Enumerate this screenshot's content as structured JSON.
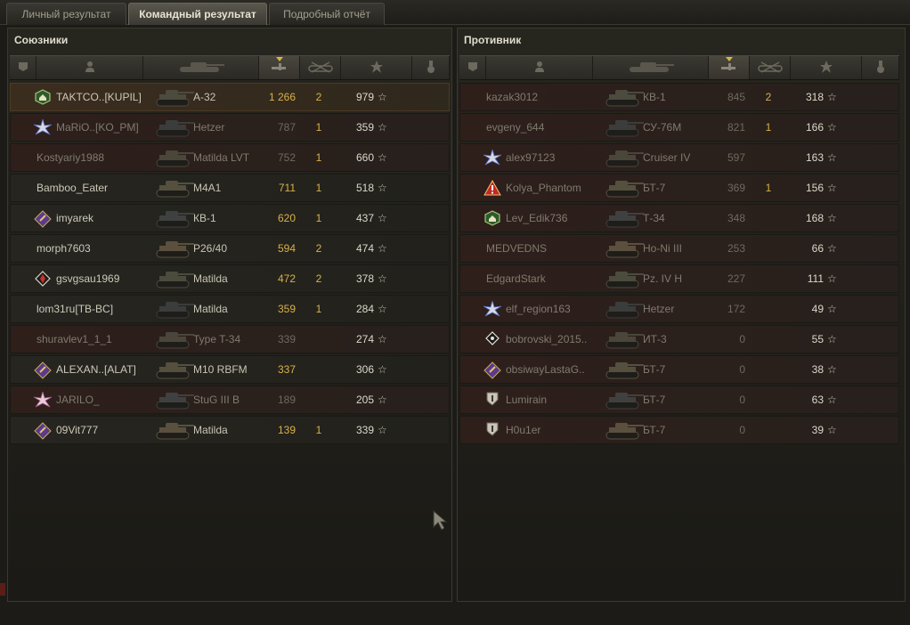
{
  "tabs": [
    "Личный результат",
    "Командный результат",
    "Подробный отчёт"
  ],
  "active_tab": 1,
  "allies": {
    "title": "Союзники",
    "rows": [
      {
        "name": "TAKTCO..[KUPIL]",
        "badge": "house-emblem-icon",
        "vehicle": "А-32",
        "damage": "1 266",
        "kills": "2",
        "xp": "979",
        "state": "me"
      },
      {
        "name": "MaRiO..[KO_PM]",
        "badge": "star-burst-icon",
        "vehicle": "Hetzer",
        "damage": "787",
        "kills": "1",
        "xp": "359",
        "state": "dead"
      },
      {
        "name": "Kostyariy1988",
        "badge": "",
        "vehicle": "Matilda LVT",
        "damage": "752",
        "kills": "1",
        "xp": "660",
        "state": "dead"
      },
      {
        "name": "Bamboo_Eater",
        "badge": "",
        "vehicle": "M4A1",
        "damage": "711",
        "kills": "1",
        "xp": "518",
        "state": "alive"
      },
      {
        "name": "imyarek",
        "badge": "purple-diamond-icon",
        "vehicle": "КВ-1",
        "damage": "620",
        "kills": "1",
        "xp": "437",
        "state": "alive"
      },
      {
        "name": "morph7603",
        "badge": "",
        "vehicle": "P26/40",
        "damage": "594",
        "kills": "2",
        "xp": "474",
        "state": "alive"
      },
      {
        "name": "gsvgsau1969",
        "badge": "red-diamond-icon",
        "vehicle": "Matilda",
        "damage": "472",
        "kills": "2",
        "xp": "378",
        "state": "alive"
      },
      {
        "name": "lom31ru[TB-BC]",
        "badge": "",
        "vehicle": "Matilda",
        "damage": "359",
        "kills": "1",
        "xp": "284",
        "state": "alive"
      },
      {
        "name": "shuravlev1_1_1",
        "badge": "",
        "vehicle": "Type T-34",
        "damage": "339",
        "kills": "",
        "xp": "274",
        "state": "dead"
      },
      {
        "name": "ALEXAN..[ALAT]",
        "badge": "purple-diamond-icon",
        "vehicle": "M10 RBFM",
        "damage": "337",
        "kills": "",
        "xp": "306",
        "state": "alive"
      },
      {
        "name": "JARILO_",
        "badge": "pink-burst-icon",
        "vehicle": "StuG III B",
        "damage": "189",
        "kills": "",
        "xp": "205",
        "state": "dead"
      },
      {
        "name": "09Vit777",
        "badge": "purple-diamond-icon",
        "vehicle": "Matilda",
        "damage": "139",
        "kills": "1",
        "xp": "339",
        "state": "alive"
      }
    ]
  },
  "enemies": {
    "title": "Противник",
    "rows": [
      {
        "name": "kazak3012",
        "badge": "",
        "vehicle": "КВ-1",
        "damage": "845",
        "kills": "2",
        "xp": "318",
        "state": "dead"
      },
      {
        "name": "evgeny_644",
        "badge": "",
        "vehicle": "СУ-76М",
        "damage": "821",
        "kills": "1",
        "xp": "166",
        "state": "dead"
      },
      {
        "name": "alex97123",
        "badge": "star-burst-icon",
        "vehicle": "Cruiser IV",
        "damage": "597",
        "kills": "",
        "xp": "163",
        "state": "dead"
      },
      {
        "name": "Kolya_Phantom",
        "badge": "red-warning-icon",
        "vehicle": "БТ-7",
        "damage": "369",
        "kills": "1",
        "xp": "156",
        "state": "dead"
      },
      {
        "name": "Lev_Edik736",
        "badge": "house-emblem-icon",
        "vehicle": "Т-34",
        "damage": "348",
        "kills": "",
        "xp": "168",
        "state": "dead"
      },
      {
        "name": "MEDVEDNS",
        "badge": "",
        "vehicle": "Ho-Ni III",
        "damage": "253",
        "kills": "",
        "xp": "66",
        "state": "dead"
      },
      {
        "name": "EdgardStark",
        "badge": "",
        "vehicle": "Pz. IV H",
        "damage": "227",
        "kills": "",
        "xp": "111",
        "state": "dead"
      },
      {
        "name": "elf_region163",
        "badge": "star-burst-icon",
        "vehicle": "Hetzer",
        "damage": "172",
        "kills": "",
        "xp": "49",
        "state": "dead"
      },
      {
        "name": "bobrovski_2015..",
        "badge": "white-diamond-icon",
        "vehicle": "ИТ-3",
        "damage": "0",
        "kills": "",
        "xp": "55",
        "state": "dead"
      },
      {
        "name": "obsiwayLastaG..",
        "badge": "purple-diamond-icon",
        "vehicle": "БТ-7",
        "damage": "0",
        "kills": "",
        "xp": "38",
        "state": "dead"
      },
      {
        "name": "Lumirain",
        "badge": "shield-icon",
        "vehicle": "БТ-7",
        "damage": "0",
        "kills": "",
        "xp": "63",
        "state": "dead"
      },
      {
        "name": "H0u1er",
        "badge": "shield-icon",
        "vehicle": "БТ-7",
        "damage": "0",
        "kills": "",
        "xp": "39",
        "state": "dead"
      }
    ]
  },
  "header_icons": [
    "squad-icon",
    "player-icon",
    "tank-icon",
    "damage-icon",
    "kills-icon",
    "xp-star-icon",
    "medal-icon"
  ],
  "colors": {
    "accent_yellow": "#d8b04a",
    "dead_row": "#2e1f1b",
    "highlight_row": "#3b2d1e"
  }
}
